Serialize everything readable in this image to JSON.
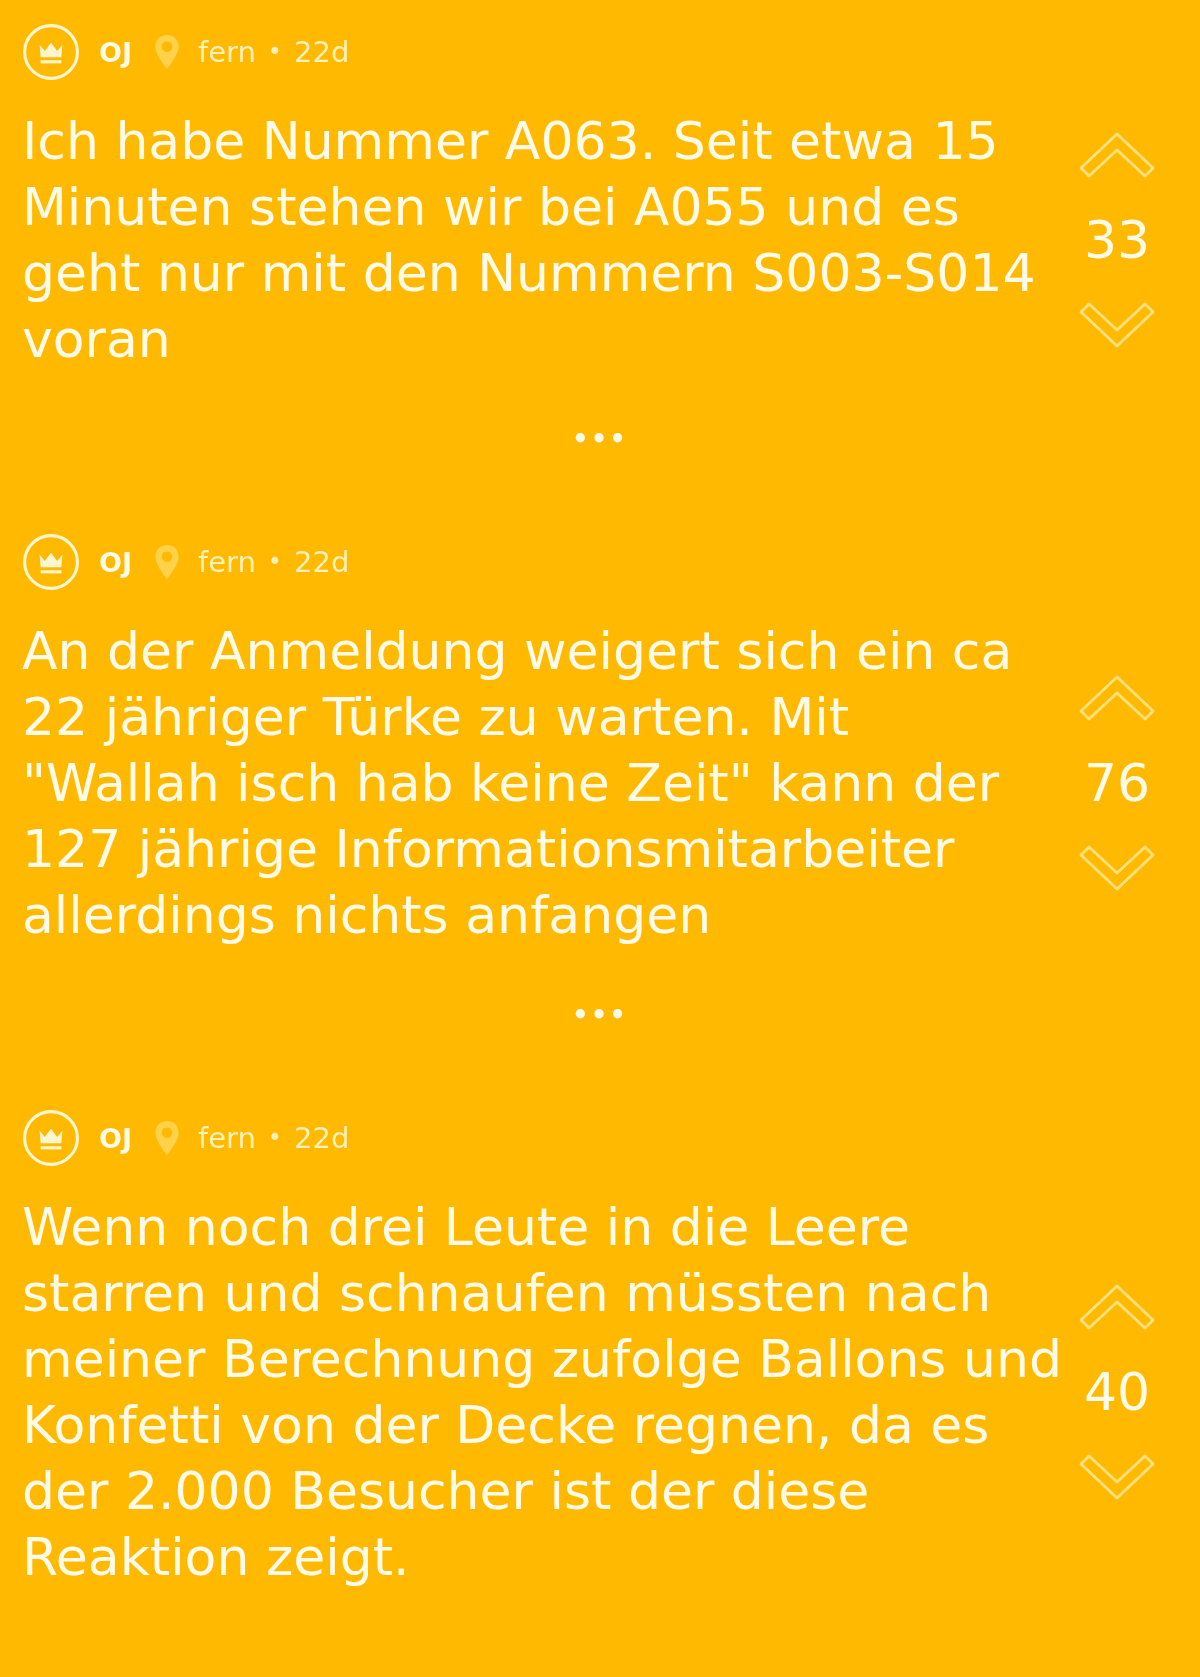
{
  "posts": [
    {
      "author": "OJ",
      "location": "fern",
      "sep": "•",
      "age": "22d",
      "text": "Ich habe Nummer A063. Seit etwa 15 Minuten stehen wir bei A055 und es geht nur mit den Nummern S003-S014 voran",
      "votes": "33",
      "more": "•••"
    },
    {
      "author": "OJ",
      "location": "fern",
      "sep": "•",
      "age": "22d",
      "text": "An der Anmeldung weigert sich ein ca 22 jähriger Türke zu warten. Mit \"Wallah isch hab keine Zeit\" kann der 127 jährige Informationsmitarbeiter allerdings nichts anfangen",
      "votes": "76",
      "more": "•••"
    },
    {
      "author": "OJ",
      "location": "fern",
      "sep": "•",
      "age": "22d",
      "text": "Wenn noch drei Leute in die Leere starren und schnaufen müssten nach meiner Berechnung zufolge Ballons und Konfetti von der Decke regnen, da es der 2.000 Besucher ist der diese Reaktion zeigt.",
      "votes": "40"
    }
  ]
}
